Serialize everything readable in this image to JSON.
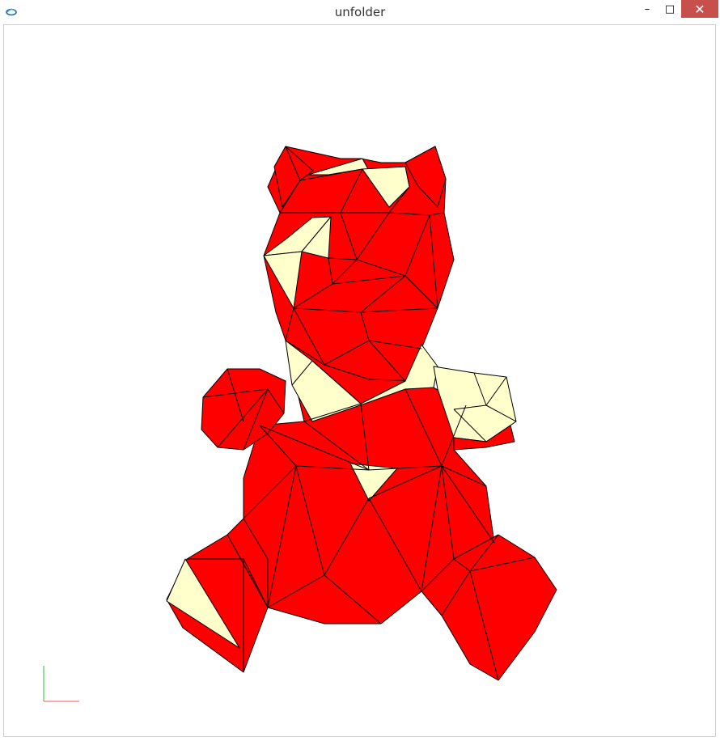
{
  "window": {
    "title": "unfolder"
  },
  "controls": {
    "minimize_glyph": "–",
    "maximize_glyph": "□",
    "close_glyph": "✕"
  },
  "icons": {
    "app": "app-icon",
    "minimize": "minimize-icon",
    "maximize": "maximize-icon",
    "close": "close-icon"
  },
  "colors": {
    "face_red": "#ff0000",
    "face_cream": "#ffffcc",
    "edge": "#000000",
    "axis_x": "#ff5555",
    "axis_y": "#33bb33",
    "close_button": "#c7504c"
  }
}
